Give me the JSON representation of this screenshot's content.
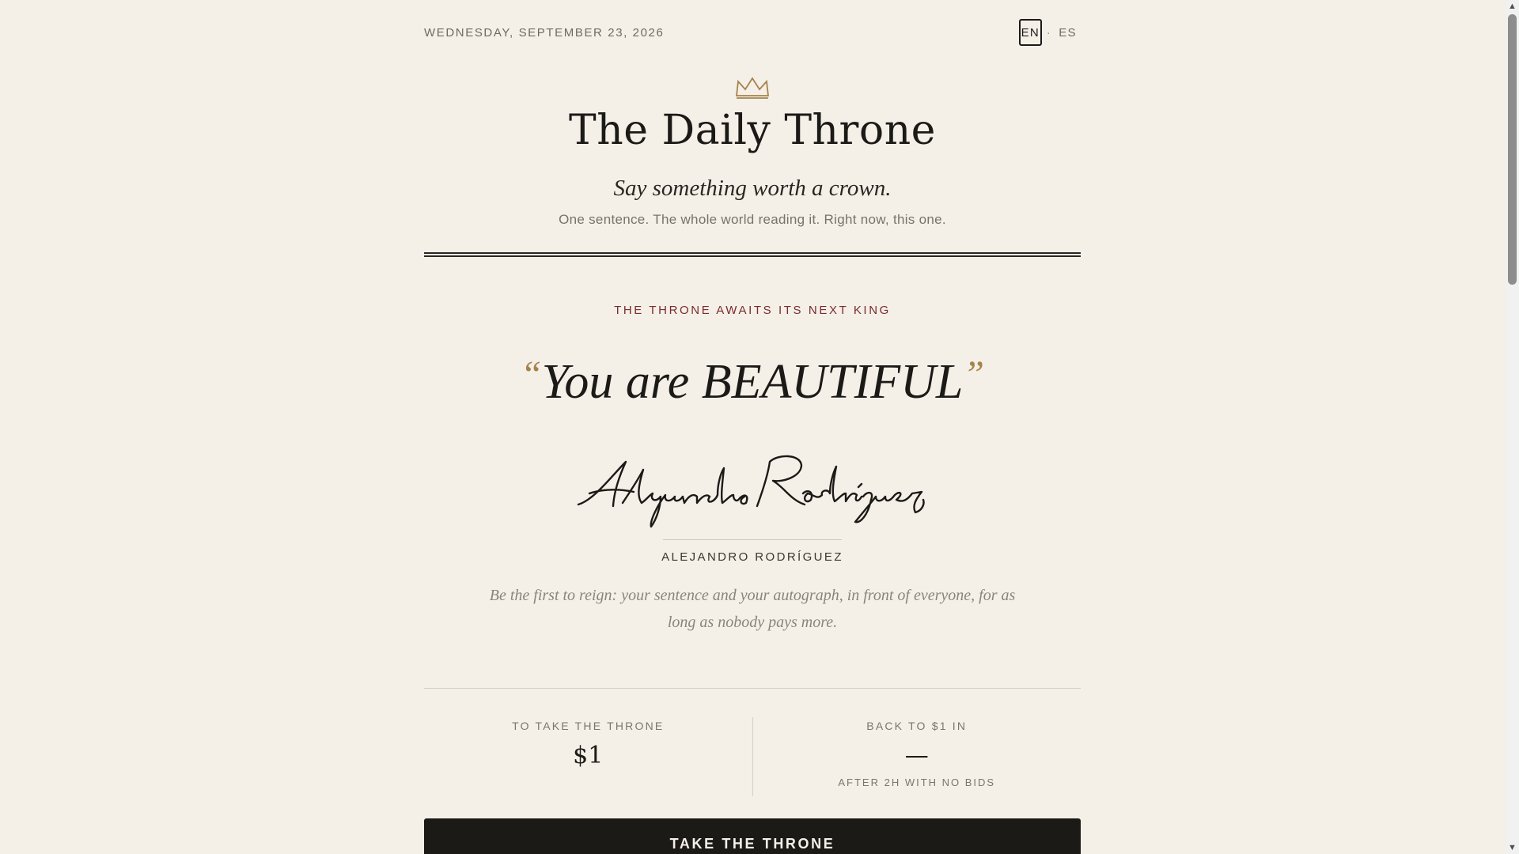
{
  "header": {
    "date": "WEDNESDAY, SEPTEMBER 23, 2026",
    "languages": [
      {
        "code": "EN",
        "active": true
      },
      {
        "code": "ES",
        "active": false
      }
    ],
    "separator": "·"
  },
  "masthead": {
    "icon": "crown-icon",
    "title": "The Daily Throne",
    "motto": "Say something worth a crown.",
    "subtitle": "One sentence. The whole world reading it. Right now, this one."
  },
  "reign": {
    "kicker": "THE THRONE AWAITS ITS NEXT KING",
    "open_quote": "“",
    "sentence": "You are BEAUTIFUL",
    "close_quote": "”",
    "signature": "Alejandro Rodríguez",
    "author": "ALEJANDRO RODRÍGUEZ",
    "invite": "Be the first to reign: your sentence and your autograph, in front of everyone, for as long as nobody pays more."
  },
  "stats": {
    "price_label": "TO TAKE THE THRONE",
    "price_value": "$1",
    "reset_label": "BACK TO $1 IN",
    "reset_value": "—",
    "reset_note": "AFTER 2H WITH NO BIDS"
  },
  "cta": {
    "label": "TAKE THE THRONE"
  },
  "colors": {
    "background": "#f4f0e8",
    "ink": "#1c1a17",
    "accent_gold": "#a7824a",
    "kicker_red": "#7a2a2e"
  },
  "scrollbar": {
    "up_icon": "scroll-up-arrow-icon",
    "down_icon": "scroll-down-arrow-icon"
  }
}
